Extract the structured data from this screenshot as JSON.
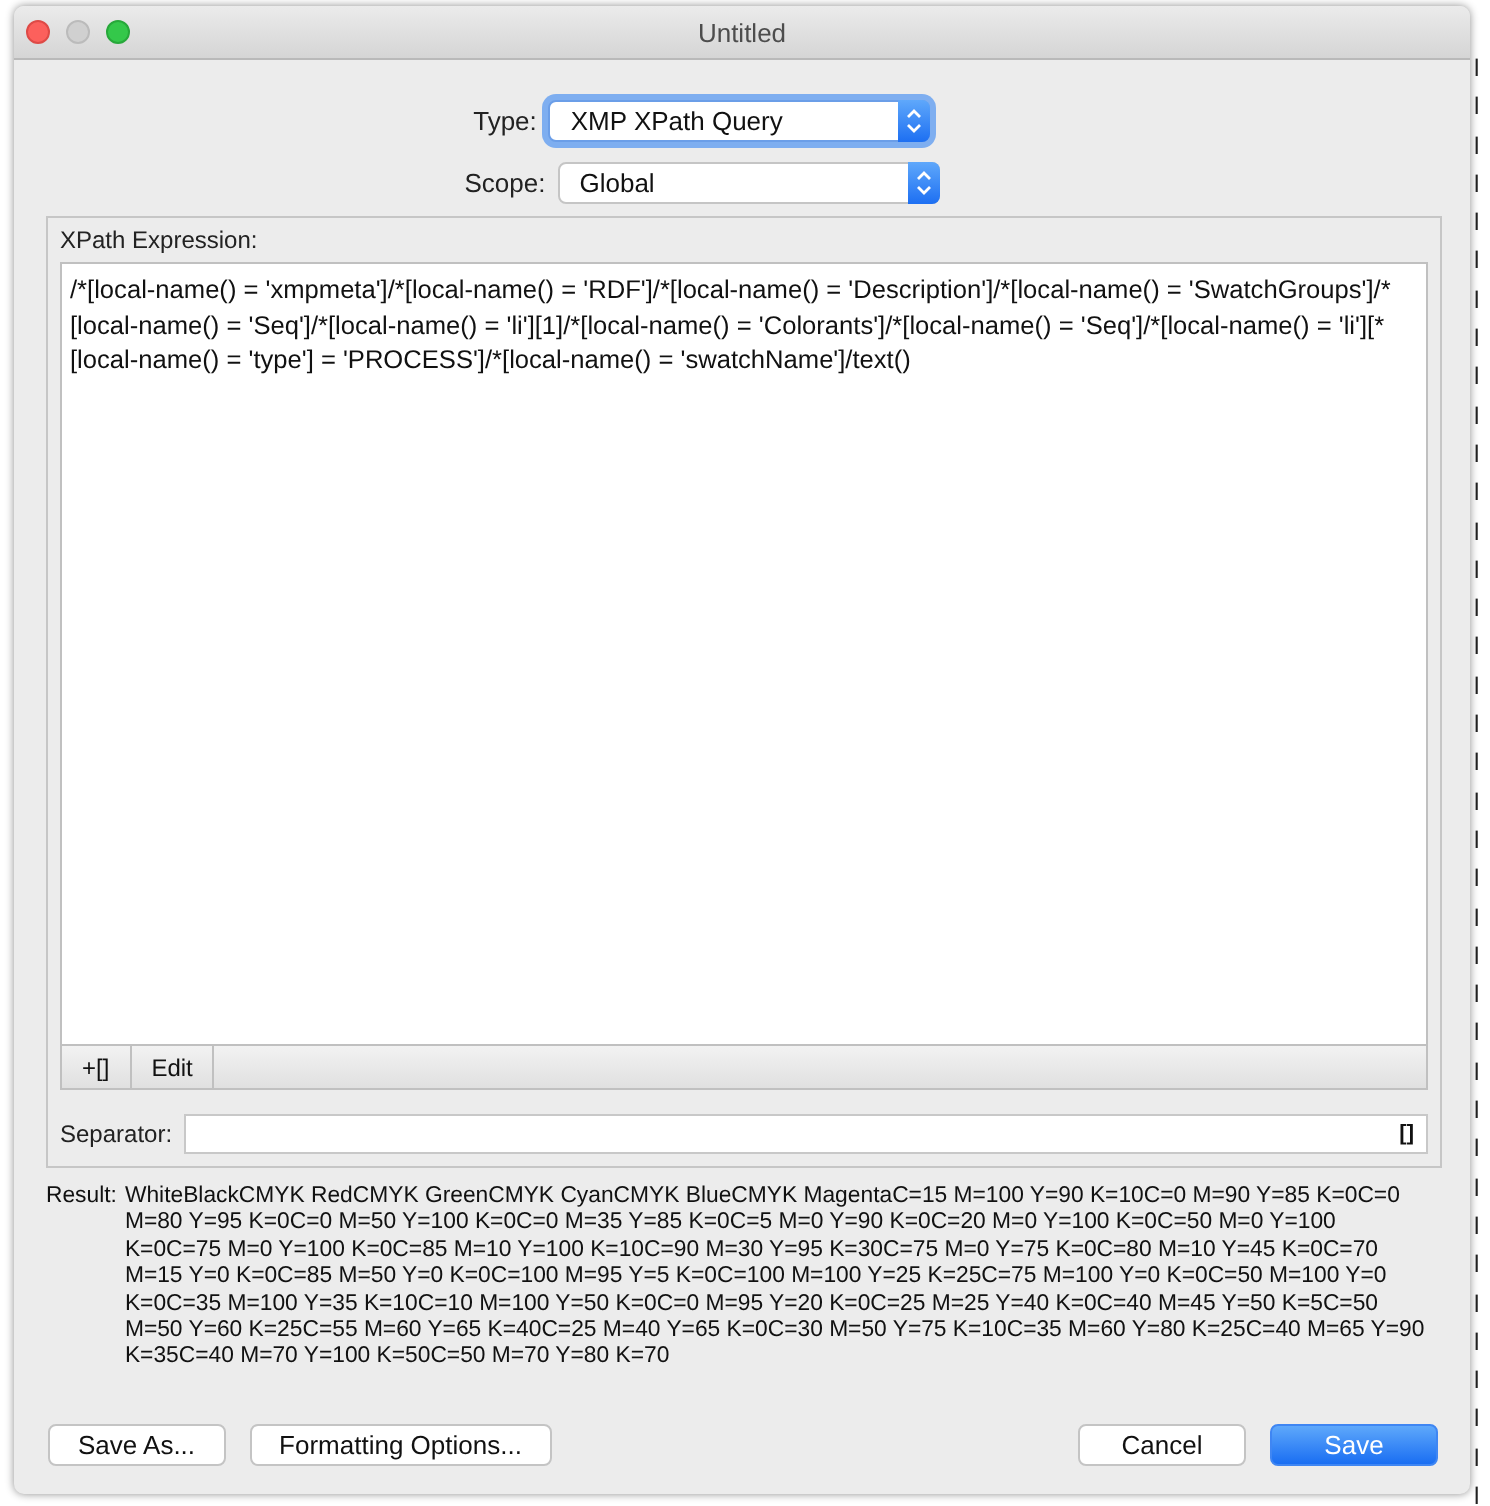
{
  "background": {
    "column_cells": [
      "l",
      "l",
      "l",
      "l",
      "l",
      "l",
      "l",
      "l",
      "l",
      "l",
      "l",
      "l",
      "l",
      "l",
      "l",
      "l",
      "l",
      "l",
      "l",
      "l",
      "l",
      "l",
      "l",
      "l",
      "l",
      "l",
      "l",
      "l",
      "l",
      "l",
      "l",
      "l",
      "l",
      "l",
      "l",
      "l",
      "l",
      "l"
    ]
  },
  "window": {
    "title": "Untitled"
  },
  "type": {
    "label": "Type:",
    "value": "XMP XPath Query",
    "focused": true
  },
  "scope": {
    "label": "Scope:",
    "value": "Global",
    "focused": false
  },
  "expression": {
    "label": "XPath Expression:",
    "value": "/*[local-name() = 'xmpmeta']/*[local-name() = 'RDF']/*[local-name() = 'Description']/*[local-name() = 'SwatchGroups']/*[local-name() = 'Seq']/*[local-name() = 'li'][1]/*[local-name() = 'Colorants']/*[local-name() = 'Seq']/*[local-name() = 'li'][*[local-name() = 'type'] = 'PROCESS']/*[local-name() = 'swatchName']/text()",
    "tools": [
      "+[]",
      "Edit"
    ]
  },
  "separator": {
    "label": "Separator:",
    "button": "[]"
  },
  "result": {
    "label": "Result:",
    "value": "WhiteBlackCMYK RedCMYK GreenCMYK CyanCMYK BlueCMYK MagentaC=15 M=100 Y=90 K=10C=0 M=90 Y=85 K=0C=0 M=80 Y=95 K=0C=0 M=50 Y=100 K=0C=0 M=35 Y=85 K=0C=5 M=0 Y=90 K=0C=20 M=0 Y=100 K=0C=50 M=0 Y=100 K=0C=75 M=0 Y=100 K=0C=85 M=10 Y=100 K=10C=90 M=30 Y=95 K=30C=75 M=0 Y=75 K=0C=80 M=10 Y=45 K=0C=70 M=15 Y=0 K=0C=85 M=50 Y=0 K=0C=100 M=95 Y=5 K=0C=100 M=100 Y=25 K=25C=75 M=100 Y=0 K=0C=50 M=100 Y=0 K=0C=35 M=100 Y=35 K=10C=10 M=100 Y=50 K=0C=0 M=95 Y=20 K=0C=25 M=25 Y=40 K=0C=40 M=45 Y=50 K=5C=50 M=50 Y=60 K=25C=55 M=60 Y=65 K=40C=25 M=40 Y=65 K=0C=30 M=50 Y=75 K=10C=35 M=60 Y=80 K=25C=40 M=65 Y=90 K=35C=40 M=70 Y=100 K=50C=50 M=70 Y=80 K=70"
  },
  "buttons_left": [
    "Save As...",
    "Formatting Options..."
  ],
  "buttons_right": [
    {
      "label": "Cancel",
      "kind": "normal"
    },
    {
      "label": "Save",
      "kind": "default"
    }
  ]
}
